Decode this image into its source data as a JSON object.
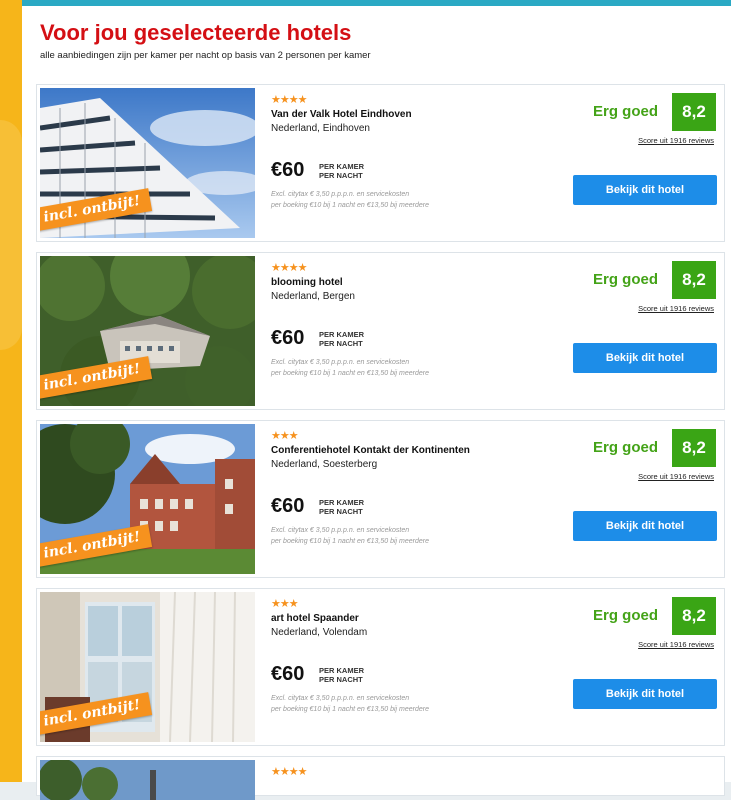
{
  "header": {
    "title": "Voor jou geselecteerde hotels",
    "subtitle": "alle aanbiedingen zijn per kamer per nacht op basis van 2 personen per kamer"
  },
  "colors": {
    "accent_red": "#d40f14",
    "rating_green": "#3aa515",
    "cta_blue": "#1d8de8",
    "badge_orange": "#f6921e"
  },
  "hotels": [
    {
      "stars": "★★★★",
      "name": "Van der Valk Hotel Eindhoven",
      "location": "Nederland, Eindhoven",
      "price": "€60",
      "unit_line1": "PER KAMER",
      "unit_line2": "PER NACHT",
      "note_line1": "Excl. citytax € 3,50 p.p.p.n. en servicekosten",
      "note_line2": "per boeking €10 bij 1 nacht en €13,50 bij meerdere",
      "rating_text": "Erg goed",
      "score": "8,2",
      "reviews": "Score uit 1916 reviews",
      "cta": "Bekijk dit hotel",
      "badge": "incl. ontbijt!"
    },
    {
      "stars": "★★★★",
      "name": "blooming hotel",
      "location": "Nederland, Bergen",
      "price": "€60",
      "unit_line1": "PER KAMER",
      "unit_line2": "PER NACHT",
      "note_line1": "Excl. citytax € 3,50 p.p.p.n. en servicekosten",
      "note_line2": "per boeking €10 bij 1 nacht en €13,50 bij meerdere",
      "rating_text": "Erg goed",
      "score": "8,2",
      "reviews": "Score uit 1916 reviews",
      "cta": "Bekijk dit hotel",
      "badge": "incl. ontbijt!"
    },
    {
      "stars": "★★★",
      "name": "Conferentiehotel Kontakt der Kontinenten",
      "location": "Nederland, Soesterberg",
      "price": "€60",
      "unit_line1": "PER KAMER",
      "unit_line2": "PER NACHT",
      "note_line1": "Excl. citytax € 3,50 p.p.p.n. en servicekosten",
      "note_line2": "per boeking €10 bij 1 nacht en €13,50 bij meerdere",
      "rating_text": "Erg goed",
      "score": "8,2",
      "reviews": "Score uit 1916 reviews",
      "cta": "Bekijk dit hotel",
      "badge": "incl. ontbijt!"
    },
    {
      "stars": "★★★",
      "name": "art hotel Spaander",
      "location": "Nederland, Volendam",
      "price": "€60",
      "unit_line1": "PER KAMER",
      "unit_line2": "PER NACHT",
      "note_line1": "Excl. citytax € 3,50 p.p.p.n. en servicekosten",
      "note_line2": "per boeking €10 bij 1 nacht en €13,50 bij meerdere",
      "rating_text": "Erg goed",
      "score": "8,2",
      "reviews": "Score uit 1916 reviews",
      "cta": "Bekijk dit hotel",
      "badge": "incl. ontbijt!"
    },
    {
      "stars": "★★★★"
    }
  ]
}
